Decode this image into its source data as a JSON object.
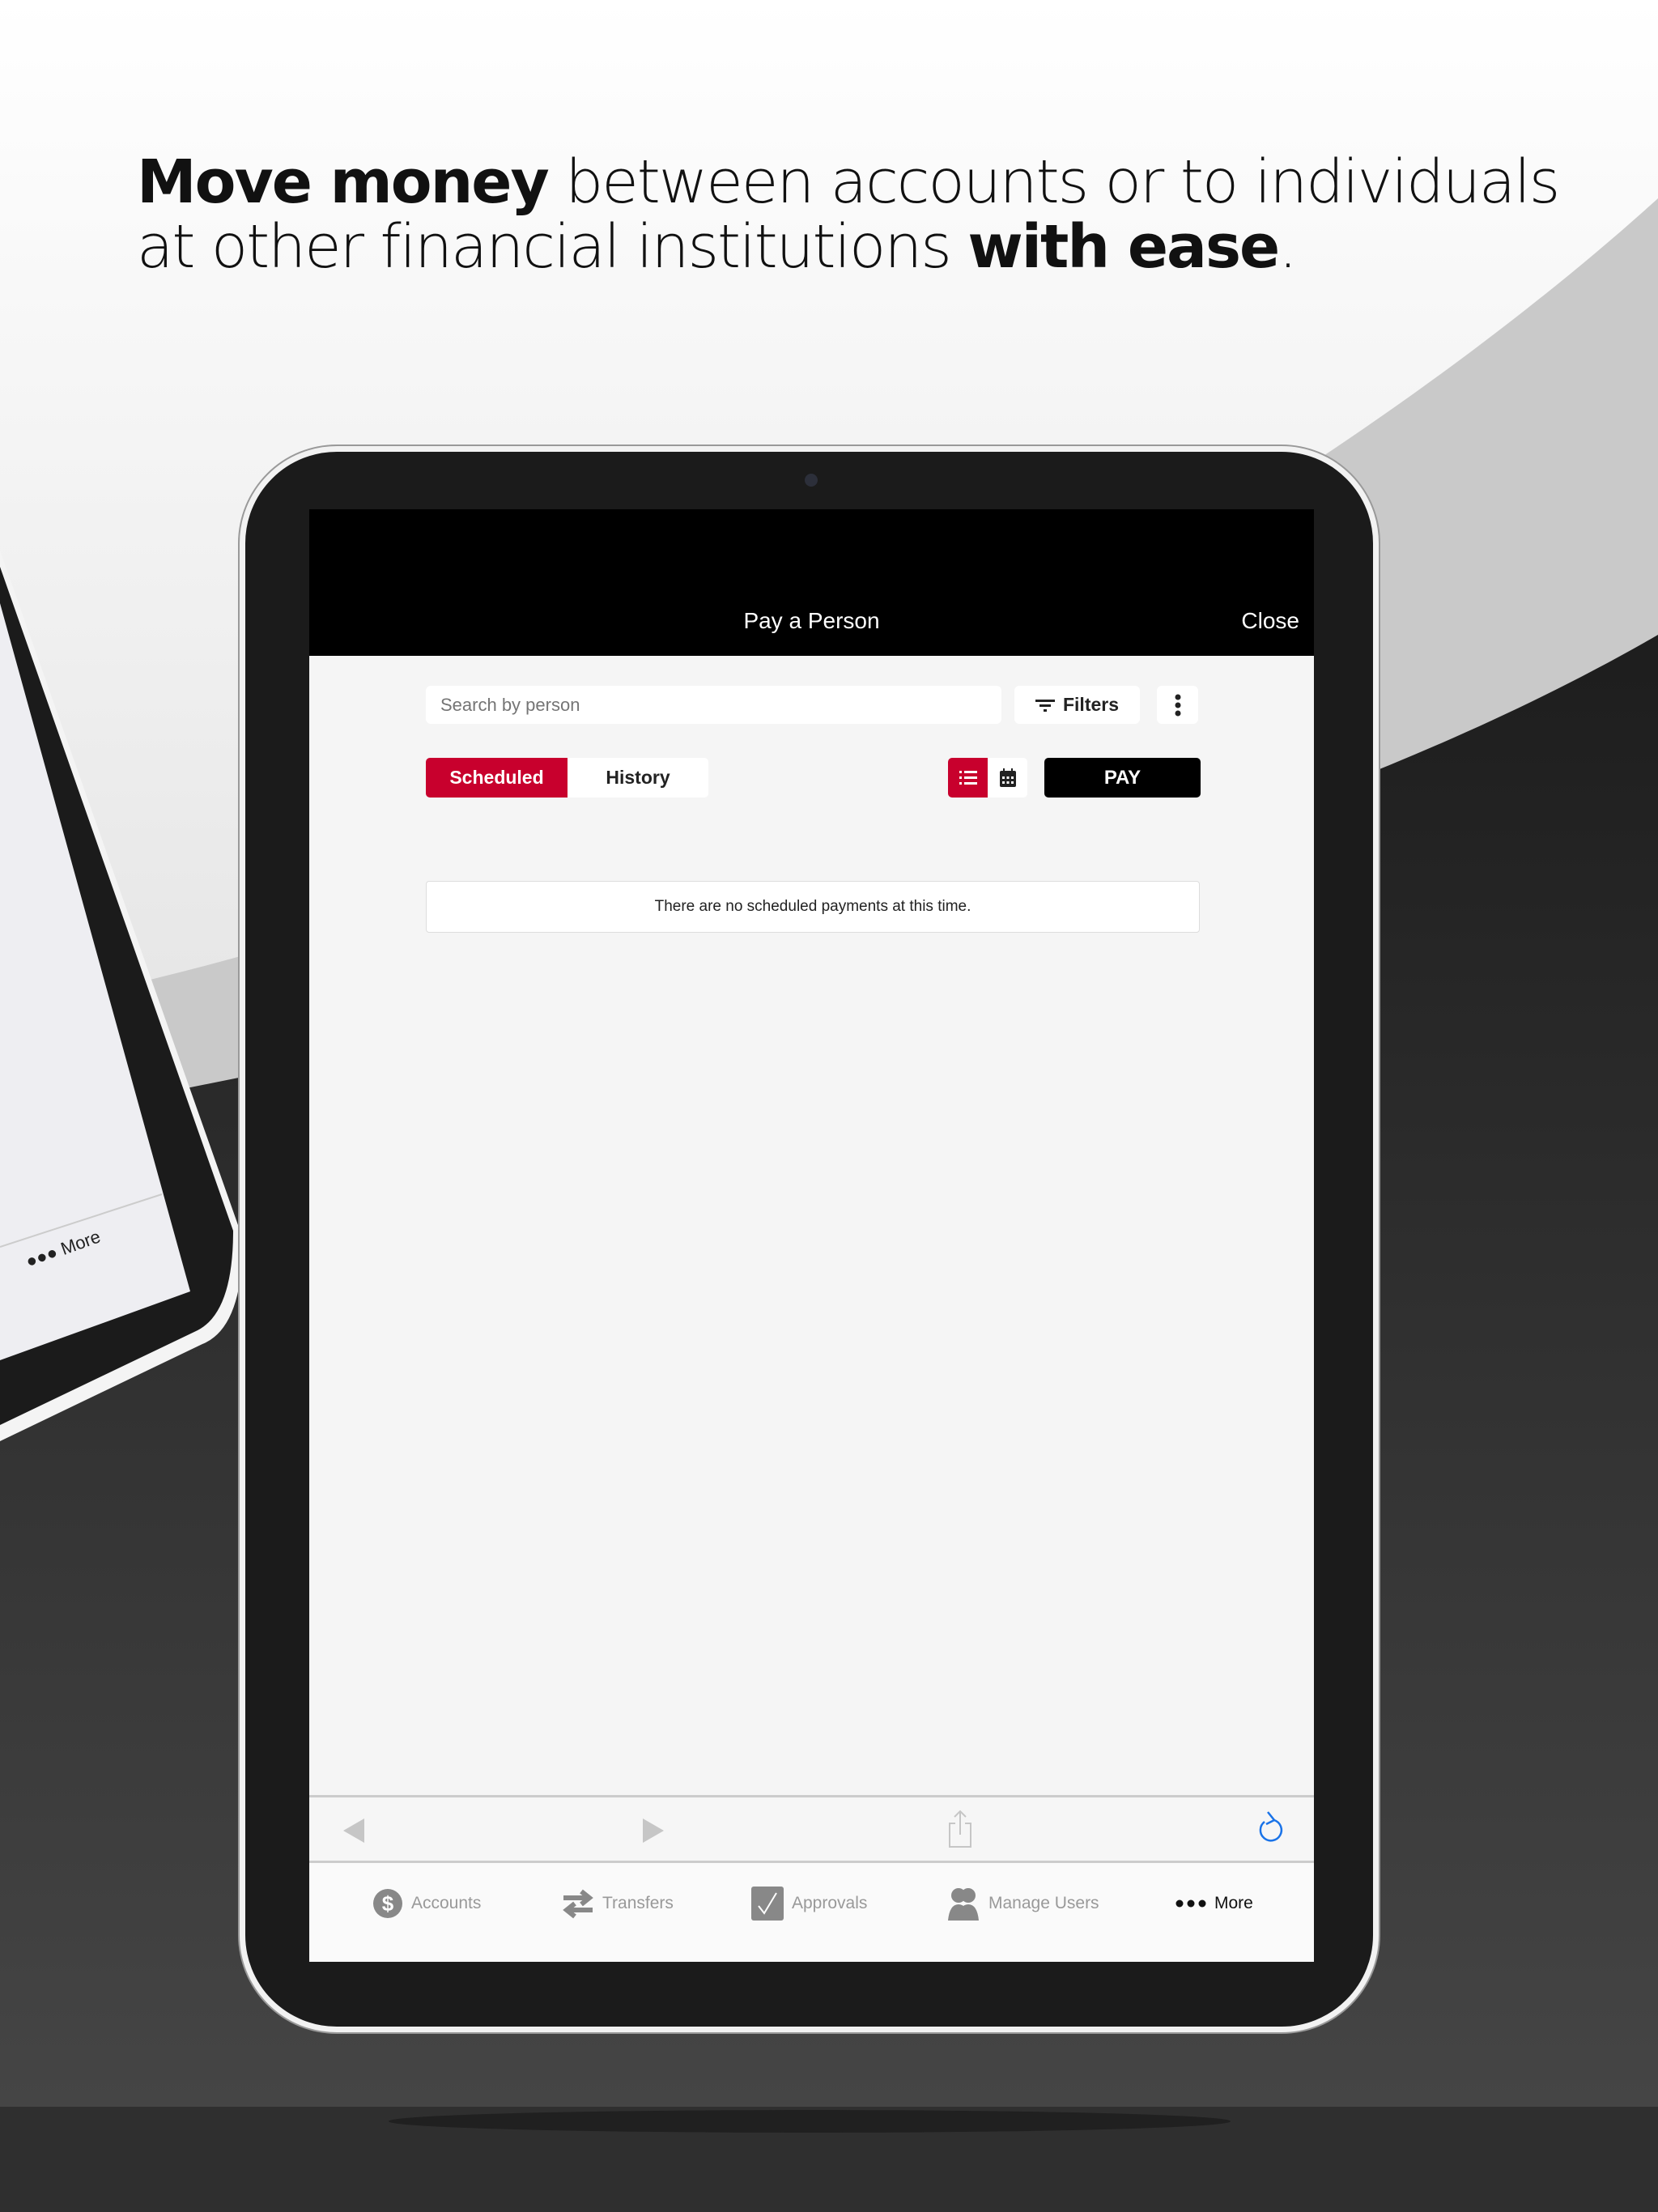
{
  "headline": {
    "bold1": "Move money",
    "text1": " between accounts or to individuals",
    "text2": "at other financial institutions ",
    "bold2": "with ease",
    "end": "."
  },
  "side_tablet": {
    "more_label": "More"
  },
  "app": {
    "title": "Pay a Person",
    "close_label": "Close",
    "search": {
      "placeholder": "Search by person",
      "value": ""
    },
    "filters_label": "Filters",
    "tabs": [
      {
        "label": "Scheduled",
        "active": true
      },
      {
        "label": "History",
        "active": false
      }
    ],
    "view_toggle": {
      "selected": "list",
      "icons": [
        "list-icon",
        "calendar-icon"
      ]
    },
    "pay_label": "PAY",
    "empty_message": "There are no scheduled payments at this time.",
    "toolbar_icons": [
      "back-icon",
      "forward-icon",
      "share-icon",
      "reload-icon"
    ],
    "bottom_tabs": [
      {
        "label": "Accounts",
        "icon": "dollar-icon"
      },
      {
        "label": "Transfers",
        "icon": "transfer-icon"
      },
      {
        "label": "Approvals",
        "icon": "checkbox-icon"
      },
      {
        "label": "Manage Users",
        "icon": "users-icon"
      },
      {
        "label": "More",
        "icon": "dots-icon",
        "active": true
      }
    ]
  },
  "colors": {
    "accent": "#c8002d",
    "header": "#000000",
    "reload": "#1a73e8"
  }
}
